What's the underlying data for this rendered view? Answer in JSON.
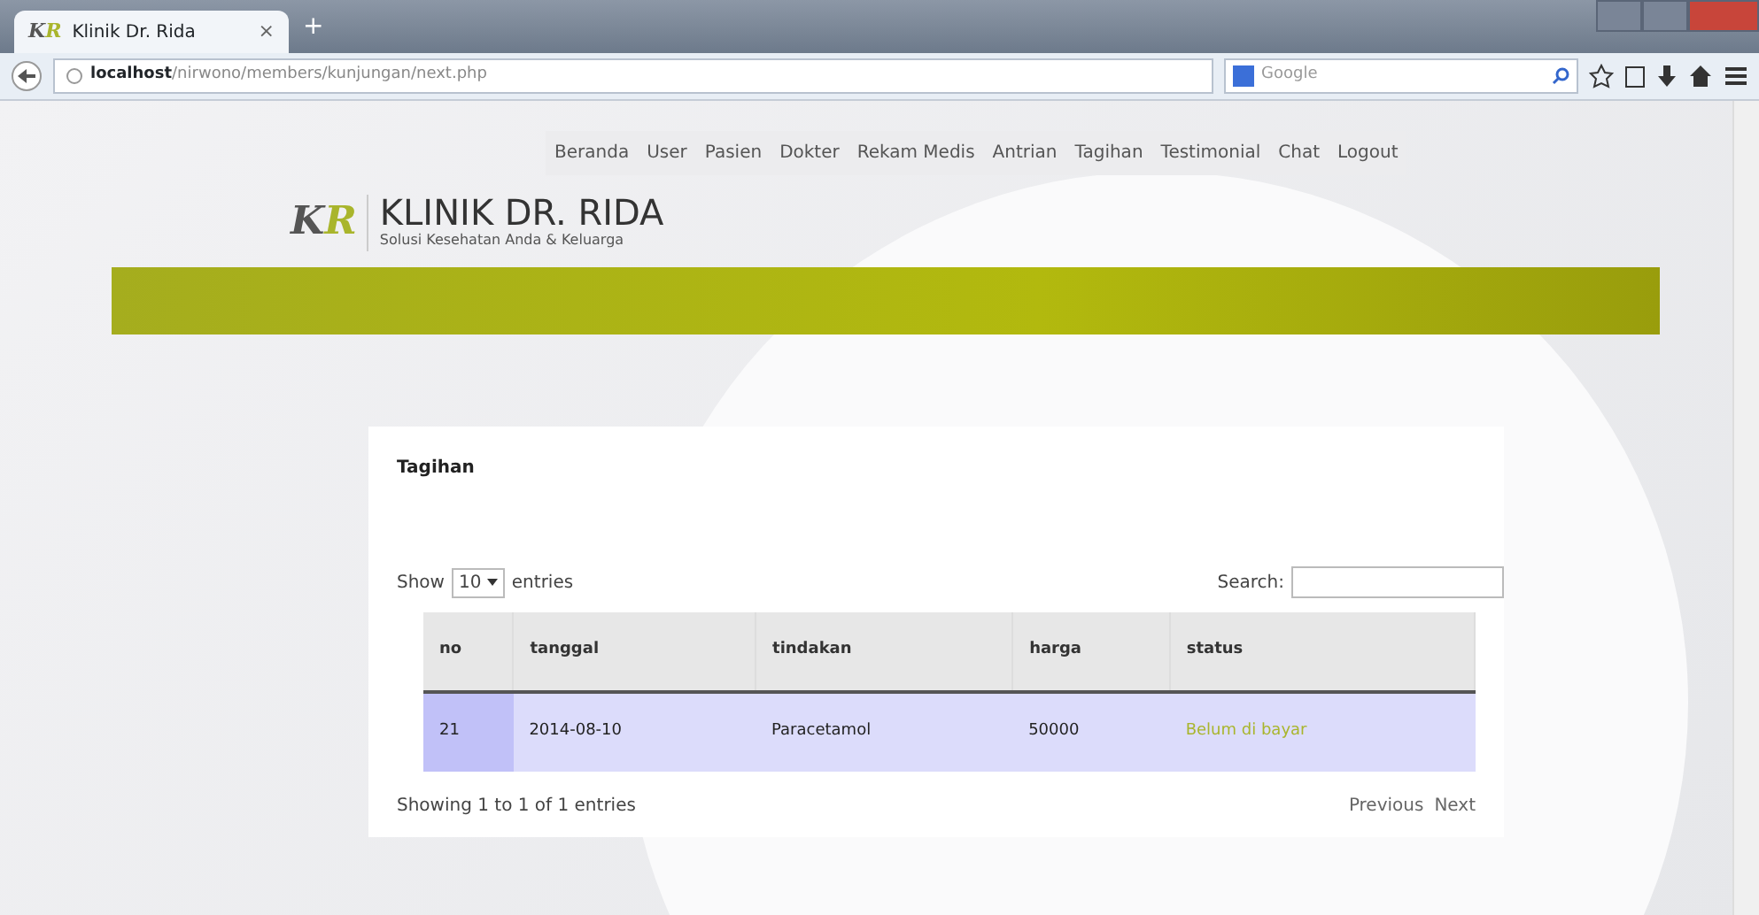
{
  "browser": {
    "favicon": [
      "K",
      "R"
    ],
    "tab_title": "Klinik Dr. Rida",
    "tab_close": "×",
    "new_tab": "+",
    "url_host": "localhost",
    "url_path": "/nirwono/members/kunjungan/next.php",
    "search_placeholder": "Google"
  },
  "nav": {
    "items": [
      "Beranda",
      "User",
      "Pasien",
      "Dokter",
      "Rekam Medis",
      "Antrian",
      "Tagihan",
      "Testimonial",
      "Chat",
      "Logout"
    ]
  },
  "logo": {
    "mark": [
      "K",
      "R"
    ],
    "title": "KLINIK DR. RIDA",
    "tagline": "Solusi Kesehatan Anda & Keluarga"
  },
  "card": {
    "title": "Tagihan",
    "show_label": "Show",
    "page_length": "10",
    "entries_label": "entries",
    "search_label": "Search:",
    "columns": [
      {
        "label": "no",
        "sorted": true
      },
      {
        "label": "tanggal",
        "sorted": false
      },
      {
        "label": "tindakan",
        "sorted": false
      },
      {
        "label": "harga",
        "sorted": false
      },
      {
        "label": "status",
        "sorted": false
      }
    ],
    "rows": [
      {
        "cells": [
          "21",
          "2014-08-10",
          "Paracetamol",
          "50000",
          "Belum di bayar"
        ]
      }
    ],
    "info": "Showing 1 to 1 of 1 entries",
    "pagination": [
      "Previous",
      "Next"
    ]
  }
}
